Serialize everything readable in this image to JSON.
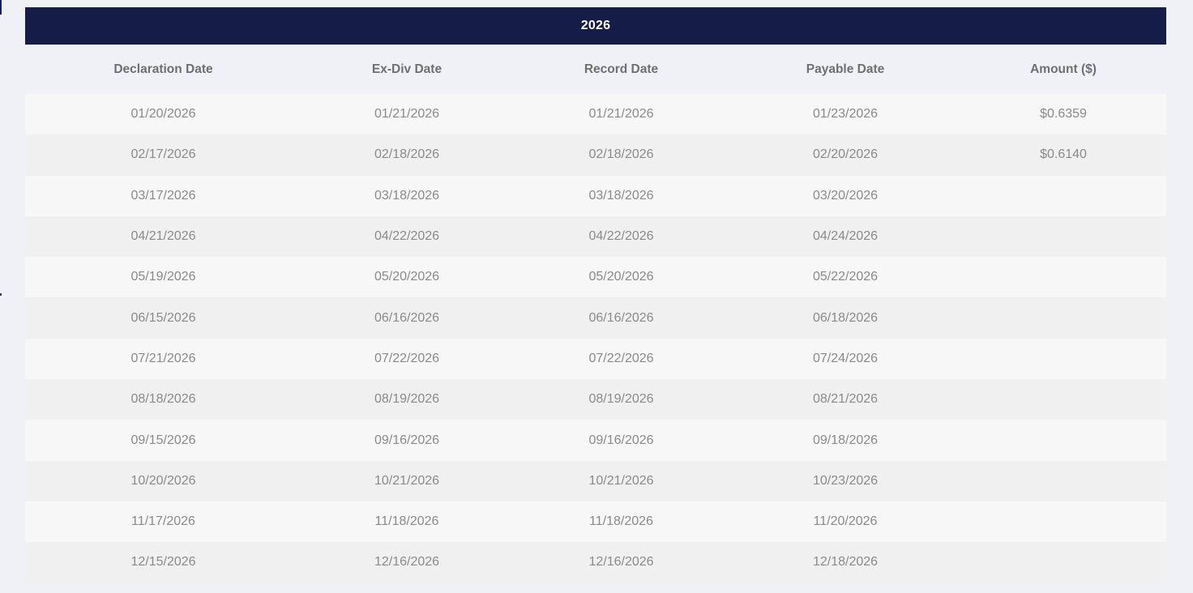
{
  "table": {
    "year": "2026",
    "headers": [
      "Declaration Date",
      "Ex-Div Date",
      "Record Date",
      "Payable Date",
      "Amount ($)"
    ],
    "rows": [
      [
        "01/20/2026",
        "01/21/2026",
        "01/21/2026",
        "01/23/2026",
        "$0.6359"
      ],
      [
        "02/17/2026",
        "02/18/2026",
        "02/18/2026",
        "02/20/2026",
        "$0.6140"
      ],
      [
        "03/17/2026",
        "03/18/2026",
        "03/18/2026",
        "03/20/2026",
        ""
      ],
      [
        "04/21/2026",
        "04/22/2026",
        "04/22/2026",
        "04/24/2026",
        ""
      ],
      [
        "05/19/2026",
        "05/20/2026",
        "05/20/2026",
        "05/22/2026",
        ""
      ],
      [
        "06/15/2026",
        "06/16/2026",
        "06/16/2026",
        "06/18/2026",
        ""
      ],
      [
        "07/21/2026",
        "07/22/2026",
        "07/22/2026",
        "07/24/2026",
        ""
      ],
      [
        "08/18/2026",
        "08/19/2026",
        "08/19/2026",
        "08/21/2026",
        ""
      ],
      [
        "09/15/2026",
        "09/16/2026",
        "09/16/2026",
        "09/18/2026",
        ""
      ],
      [
        "10/20/2026",
        "10/21/2026",
        "10/21/2026",
        "10/23/2026",
        ""
      ],
      [
        "11/17/2026",
        "11/18/2026",
        "11/18/2026",
        "11/20/2026",
        ""
      ],
      [
        "12/15/2026",
        "12/16/2026",
        "12/16/2026",
        "12/18/2026",
        ""
      ]
    ]
  },
  "colors": {
    "header_bar": "#141c47",
    "header_text": "#ffffff",
    "row_odd": "#f7f7f7",
    "row_even": "#f0f0f0",
    "body_text": "#8a8a8a",
    "column_header_text": "#6f6f6f",
    "page_background": "#eff1f6"
  }
}
